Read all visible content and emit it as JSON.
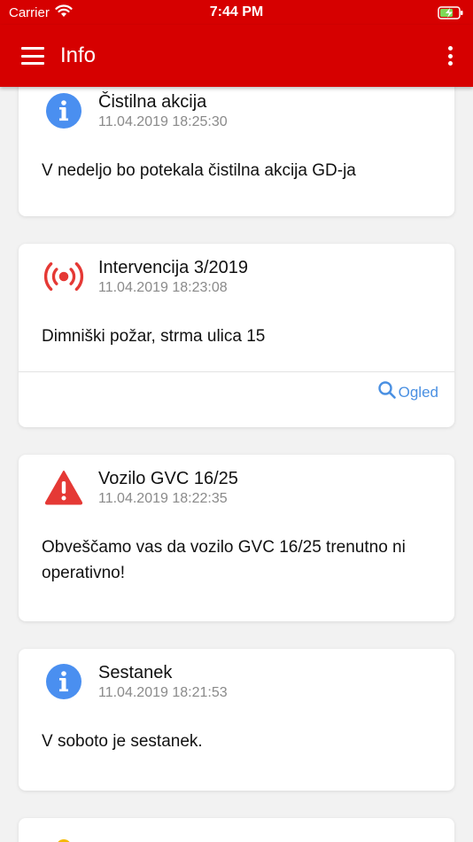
{
  "statusbar": {
    "carrier": "Carrier",
    "time": "7:44 PM"
  },
  "appbar": {
    "title": "Info"
  },
  "colors": {
    "brand": "#d60000",
    "info_icon": "#4a8ff0",
    "alert_icon": "#e53935",
    "link": "#4a90e2"
  },
  "cards": [
    {
      "icon": "info-icon",
      "title": "Čistilna akcija",
      "date": "11.04.2019 18:25:30",
      "body": "V nedeljo bo potekala čistilna akcija GD-ja"
    },
    {
      "icon": "broadcast-icon",
      "title": "Intervencija 3/2019",
      "date": "11.04.2019 18:23:08",
      "body": "Dimniški požar, strma ulica 15",
      "action_label": "Ogled"
    },
    {
      "icon": "warning-icon",
      "title": "Vozilo GVC 16/25",
      "date": "11.04.2019 18:22:35",
      "body": "Obveščamo vas da vozilo GVC 16/25 trenutno ni operativno!"
    },
    {
      "icon": "info-icon",
      "title": "Sestanek",
      "date": "11.04.2019 18:21:53",
      "body": "V soboto je sestanek."
    }
  ]
}
